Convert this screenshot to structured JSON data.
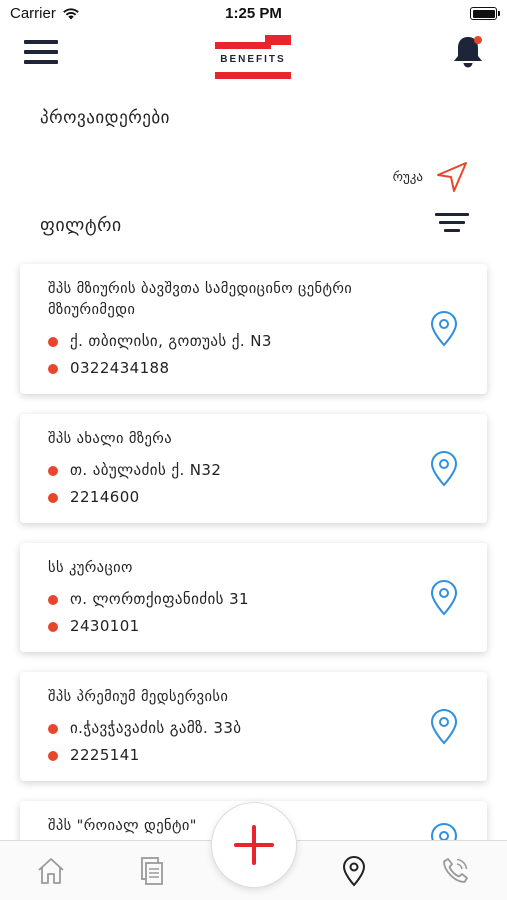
{
  "status_bar": {
    "carrier": "Carrier",
    "time": "1:25 PM"
  },
  "header": {
    "logo_text": "BENEFITS"
  },
  "page": {
    "title": "პროვაიდერები",
    "map_label": "რუკა",
    "filter_label": "ფილტრი"
  },
  "providers": [
    {
      "name": "შპს მზიურის ბავშვთა სამედიცინო ცენტრი მზიურიმედი",
      "address": "ქ. თბილისი, გოთუას ქ. N3",
      "phone": "0322434188"
    },
    {
      "name": "შპს ახალი მზერა",
      "address": "თ. აბულაძის ქ. N32",
      "phone": "2214600"
    },
    {
      "name": "სს კურაციო",
      "address": "ო. ლორთქიფანიძის 31",
      "phone": "2430101"
    },
    {
      "name": "შპს პრემიუმ მედსერვისი",
      "address": "ი.ჭავჭავაძის გამზ. 33ბ",
      "phone": "2225141"
    },
    {
      "name": "შპს \"როიალ დენტი\"",
      "address": "",
      "phone": ""
    }
  ],
  "colors": {
    "accent": "#e8462c",
    "navy": "#1e2538",
    "pin": "#2f8fe0",
    "tab_icon": "#9a9a9a"
  },
  "tabs": [
    {
      "name": "home",
      "icon": "home-icon"
    },
    {
      "name": "documents",
      "icon": "documents-icon"
    },
    {
      "name": "map",
      "icon": "location-pin-icon"
    },
    {
      "name": "call",
      "icon": "phone-icon"
    }
  ]
}
